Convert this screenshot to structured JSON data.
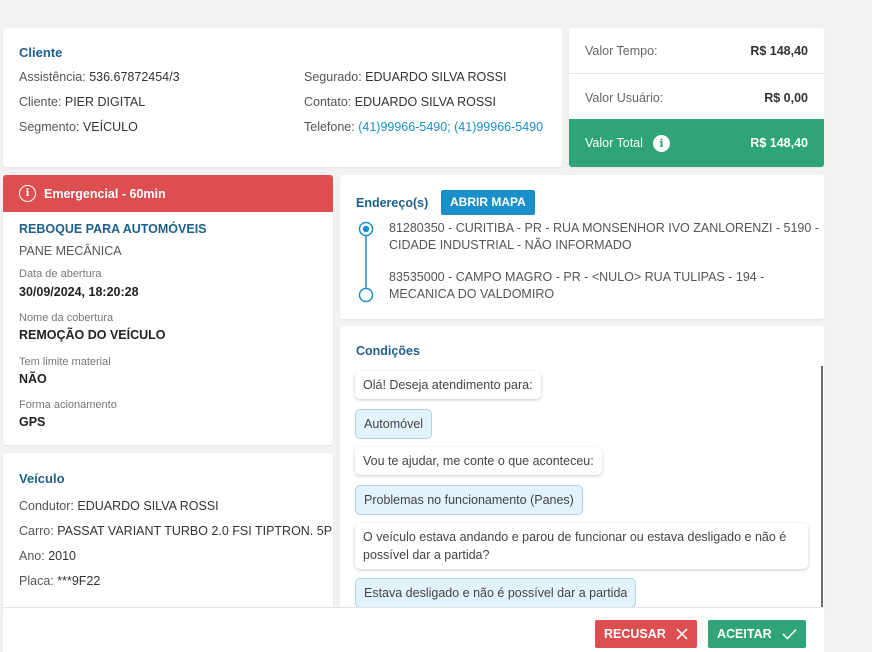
{
  "cliente": {
    "title": "Cliente",
    "assistencia_label": "Assistência:",
    "assistencia_value": "536.67872454/3",
    "cliente_label": "Cliente:",
    "cliente_value": "PIER DIGITAL",
    "segmento_label": "Segmento:",
    "segmento_value": "VEÍCULO",
    "segurado_label": "Segurado:",
    "segurado_value": "EDUARDO SILVA ROSSI",
    "contato_label": "Contato:",
    "contato_value": "EDUARDO SILVA ROSSI",
    "telefone_label": "Telefone:",
    "telefone_value": "(41)99966-5490; (41)99966-5490"
  },
  "valores": {
    "tempo_label": "Valor Tempo:",
    "tempo_value": "R$ 148,40",
    "usuario_label": "Valor Usuário:",
    "usuario_value": "R$ 0,00",
    "total_label": "Valor Total",
    "total_value": "R$ 148,40",
    "total_color": "#2ea478"
  },
  "servico": {
    "badge": "Emergencial - 60min",
    "badge_color": "#dc4e4f",
    "tipo": "REBOQUE PARA AUTOMÓVEIS",
    "problema": "PANE MECÂNICA",
    "data_label": "Data de abertura",
    "data_value": "30/09/2024, 18:20:28",
    "cobertura_label": "Nome da cobertura",
    "cobertura_value": "REMOÇÃO DO VEÍCULO",
    "limite_label": "Tem limite material",
    "limite_value": "NÃO",
    "forma_label": "Forma acionamento",
    "forma_value": "GPS"
  },
  "veiculo": {
    "title": "Veículo",
    "condutor_label": "Condutor:",
    "condutor_value": "EDUARDO SILVA ROSSI",
    "carro_label": "Carro:",
    "carro_value": "PASSAT VARIANT TURBO 2.0 FSI TIPTRON. 5P",
    "ano_label": "Ano:",
    "ano_value": "2010",
    "placa_label": "Placa:",
    "placa_value": "***9F22"
  },
  "endereco": {
    "title": "Endereço(s)",
    "map_button": "ABRIR MAPA",
    "origem_line1": "81280350 - CURITIBA - PR - RUA MONSENHOR IVO ZANLORENZI - 5190 -",
    "origem_line2": "CIDADE INDUSTRIAL - NÃO INFORMADO",
    "destino_line1": "83535000 - CAMPO MAGRO - PR - <NULO> RUA TULIPAS - 194 -",
    "destino_line2": "MECANICA DO VALDOMIRO"
  },
  "condicoes": {
    "title": "Condições",
    "messages": [
      "Olá! Deseja atendimento para:",
      "Automóvel",
      "Vou te ajudar, me conte o que aconteceu:",
      "Problemas no funcionamento (Panes)",
      "O veículo estava andando e parou de funcionar ou estava desligado e não é",
      "possível dar a partida?",
      "Estava desligado e não é possível dar a partida"
    ]
  },
  "acoes": {
    "recusar": "RECUSAR",
    "aceitar": "ACEITAR",
    "recusar_color": "#dc4e4f",
    "aceitar_color": "#2ea478"
  }
}
